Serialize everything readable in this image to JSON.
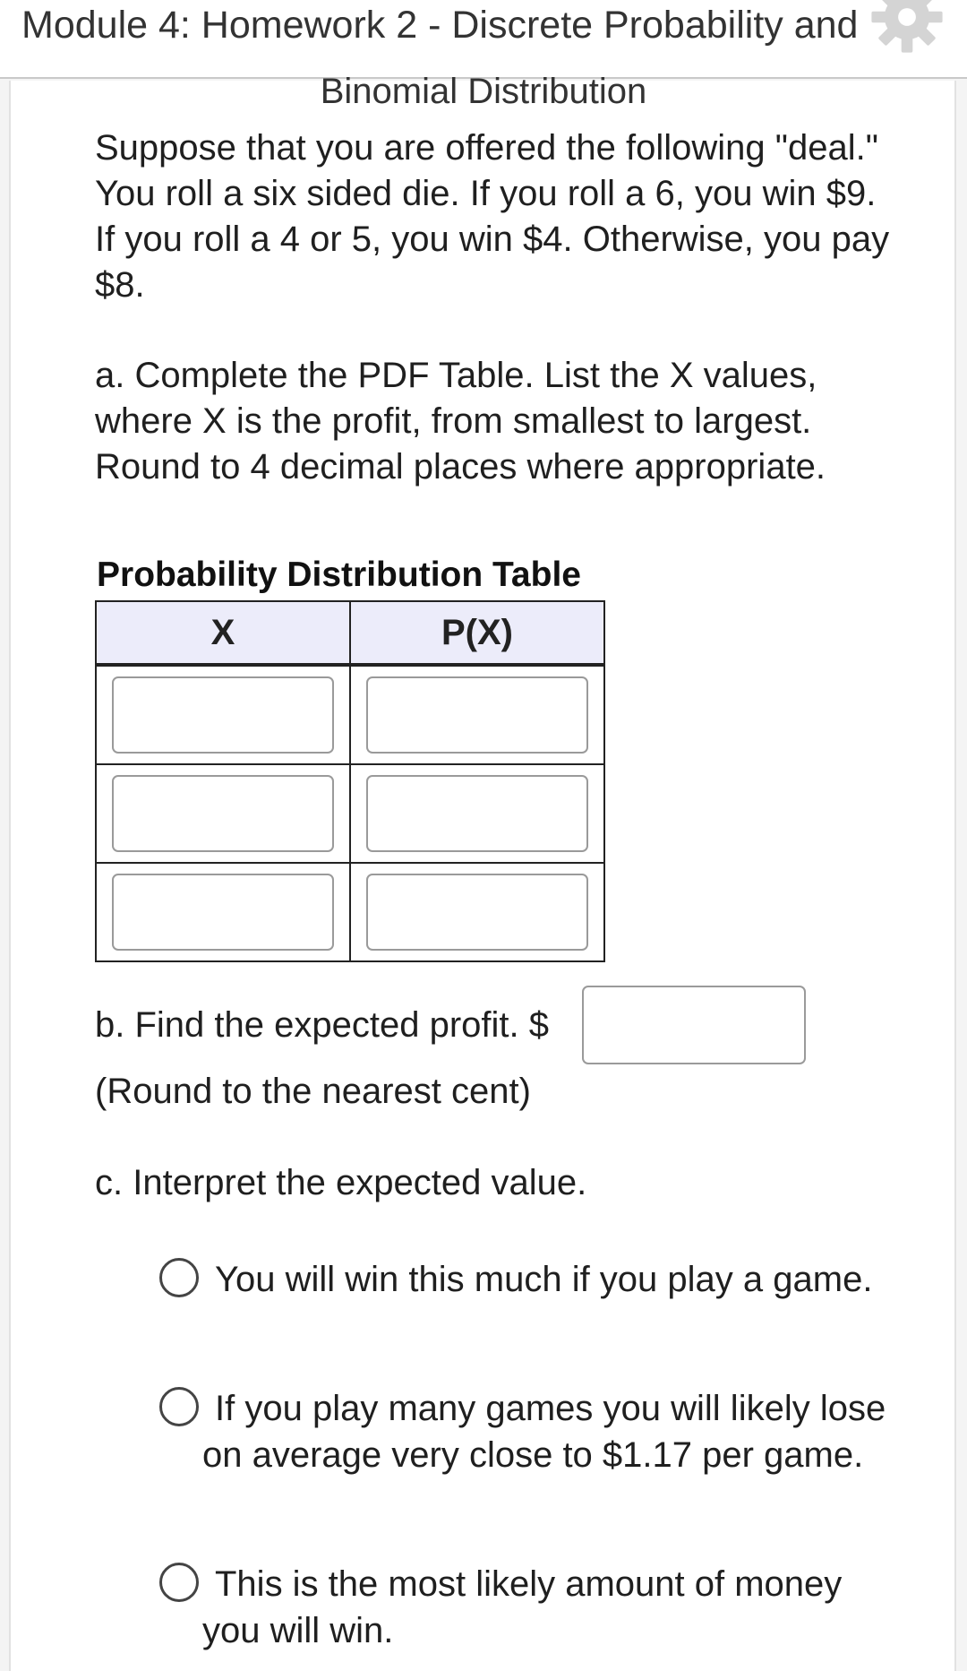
{
  "header": {
    "title_line1": "Module 4: Homework 2 - Discrete Probability and",
    "title_line2": "Binomial Distribution",
    "settings_icon": "gear-icon"
  },
  "question": {
    "intro": "Suppose that you are offered the following \"deal.\" You roll a six sided die. If you roll a 6, you win $9. If you roll a 4 or 5, you win $4. Otherwise, you pay $8.",
    "part_a": "a. Complete the PDF Table. List the X values, where X is the profit, from smallest to largest. Round to 4 decimal places where appropriate.",
    "table": {
      "caption": "Probability Distribution Table",
      "headers": [
        "X",
        "P(X)"
      ],
      "rows": [
        {
          "x": "",
          "px": ""
        },
        {
          "x": "",
          "px": ""
        },
        {
          "x": "",
          "px": ""
        }
      ]
    },
    "part_b": {
      "label": "b. Find the expected profit. $",
      "value": "",
      "note": "(Round to the nearest cent)"
    },
    "part_c": {
      "label": "c. Interpret the expected value.",
      "options": [
        "You will win this much if you play a game.",
        "If you play many games you will likely lose on average very close to $1.17 per game.",
        "This is the most likely amount of money you will win."
      ]
    }
  }
}
